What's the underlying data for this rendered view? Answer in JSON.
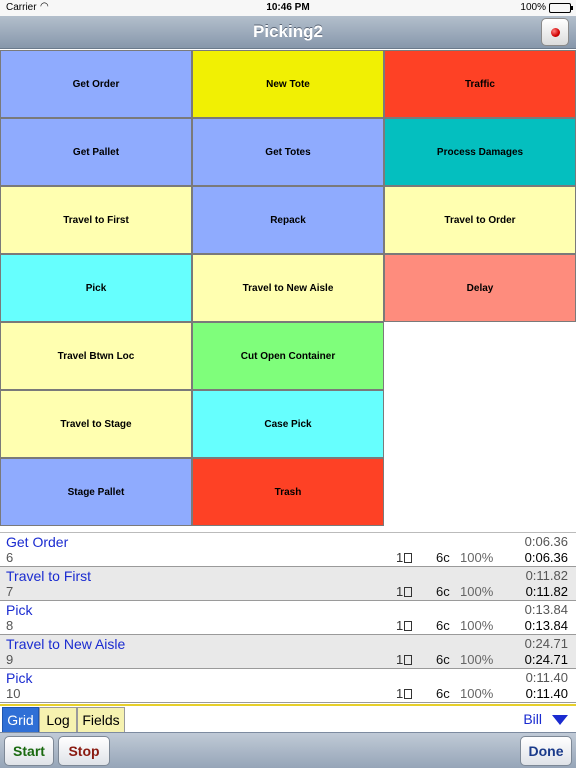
{
  "status_bar": {
    "carrier": "Carrier",
    "time": "10:46 PM",
    "battery": "100%"
  },
  "nav": {
    "title": "Picking2",
    "record_icon": "record-dot-icon"
  },
  "grid": {
    "cells": [
      {
        "label": "Get Order",
        "color": "#8fabfe"
      },
      {
        "label": "New Tote",
        "color": "#f1f003"
      },
      {
        "label": "Traffic",
        "color": "#fe4125"
      },
      {
        "label": "Get Pallet",
        "color": "#8fabfe"
      },
      {
        "label": "Get Totes",
        "color": "#8fabfe"
      },
      {
        "label": "Process Damages",
        "color": "#04bfbf"
      },
      {
        "label": "Travel to First",
        "color": "#ffffb0"
      },
      {
        "label": "Repack",
        "color": "#8fabfe"
      },
      {
        "label": "Travel to Order",
        "color": "#ffffb0"
      },
      {
        "label": "Pick",
        "color": "#66fffe"
      },
      {
        "label": "Travel to New Aisle",
        "color": "#ffffb0"
      },
      {
        "label": "Delay",
        "color": "#fe8c7d"
      },
      {
        "label": "Travel Btwn Loc",
        "color": "#ffffb0"
      },
      {
        "label": "Cut Open Container",
        "color": "#7ffe7b"
      },
      {
        "label": "Travel to Stage",
        "color": "#ffffb0"
      },
      {
        "label": "Case Pick",
        "color": "#66fffe"
      },
      {
        "label": "Stage Pallet",
        "color": "#8fabfe"
      },
      {
        "label": "Trash",
        "color": "#fe4125"
      }
    ]
  },
  "log": {
    "rows": [
      {
        "name": "Get Order",
        "num": "6",
        "elapsed": "0:06.36",
        "qty": "1",
        "units": "6c",
        "pct": "100%",
        "total": "0:06.36"
      },
      {
        "name": "Travel to First",
        "num": "7",
        "elapsed": "0:11.82",
        "qty": "1",
        "units": "6c",
        "pct": "100%",
        "total": "0:11.82"
      },
      {
        "name": "Pick",
        "num": "8",
        "elapsed": "0:13.84",
        "qty": "1",
        "units": "6c",
        "pct": "100%",
        "total": "0:13.84"
      },
      {
        "name": "Travel to New Aisle",
        "num": "9",
        "elapsed": "0:24.71",
        "qty": "1",
        "units": "6c",
        "pct": "100%",
        "total": "0:24.71"
      },
      {
        "name": "Pick",
        "num": "10",
        "elapsed": "0:11.40",
        "qty": "1",
        "units": "6c",
        "pct": "100%",
        "total": "0:11.40"
      }
    ]
  },
  "tabs": [
    {
      "label": "Grid",
      "active": true
    },
    {
      "label": "Log",
      "active": false
    },
    {
      "label": "Fields",
      "active": false
    }
  ],
  "user": {
    "name": "Bill",
    "icon": "chevron-down-icon"
  },
  "toolbar": {
    "start": "Start",
    "stop": "Stop",
    "done": "Done",
    "start_color": "#1a6a10",
    "stop_color": "#8a1a10",
    "done_color": "#1a3a8a"
  }
}
